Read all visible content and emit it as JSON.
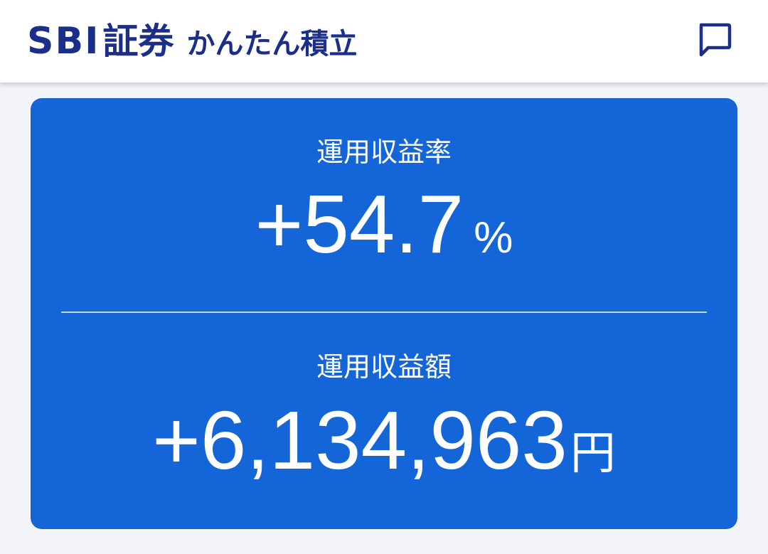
{
  "header": {
    "brand_sbi": "SBI",
    "brand_shoken": "証券",
    "product_name": "かんたん積立",
    "chat_icon": "chat-bubble-icon"
  },
  "colors": {
    "brand_navy": "#1b2f8a",
    "card_blue": "#1465d8",
    "background": "#f3f4f8"
  },
  "summary": {
    "return_rate": {
      "label": "運用収益率",
      "value": "+54.7",
      "unit": "%"
    },
    "return_amount": {
      "label": "運用収益額",
      "value": "+6,134,963",
      "unit": "円"
    }
  }
}
